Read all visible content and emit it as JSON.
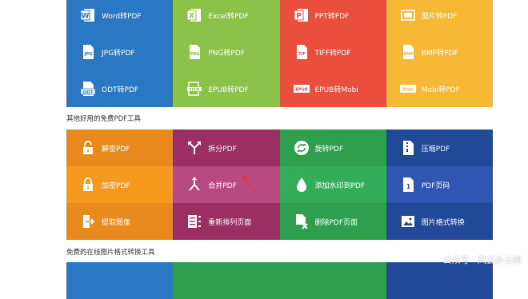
{
  "section1": {
    "tiles": [
      {
        "label": "Word转PDF",
        "icon": "word-doc-icon",
        "color": "#2a78c4"
      },
      {
        "label": "Excel转PDF",
        "icon": "excel-doc-icon",
        "color": "#8bc34a"
      },
      {
        "label": "PPT转PDF",
        "icon": "ppt-doc-icon",
        "color": "#e94f3c"
      },
      {
        "label": "图片转PDF",
        "icon": "image-frame-icon",
        "color": "#f6b935"
      },
      {
        "label": "JPG转PDF",
        "icon": "jpg-file-icon",
        "color": "#2a78c4"
      },
      {
        "label": "PNG转PDF",
        "icon": "png-file-icon",
        "color": "#8bc34a"
      },
      {
        "label": "TIFF转PDF",
        "icon": "tiff-file-icon",
        "color": "#e94f3c"
      },
      {
        "label": "BMP转PDF",
        "icon": "bmp-file-icon",
        "color": "#f6b935"
      },
      {
        "label": "ODT转PDF",
        "icon": "odt-file-icon",
        "color": "#2a78c4"
      },
      {
        "label": "EPUB转PDF",
        "icon": "epub-book-icon",
        "color": "#8bc34a"
      },
      {
        "label": "EPUB转Mobi",
        "icon": "epub-badge-icon",
        "color": "#e94f3c"
      },
      {
        "label": "Mobi转PDF",
        "icon": "mobi-badge-icon",
        "color": "#f6b935"
      }
    ]
  },
  "section2": {
    "title": "其他好用的免费PDF工具",
    "tiles": [
      {
        "label": "解密PDF",
        "icon": "unlock-icon",
        "color": "#e88a1d"
      },
      {
        "label": "拆分PDF",
        "icon": "split-arrows-icon",
        "color": "#9c2f62"
      },
      {
        "label": "旋转PDF",
        "icon": "rotate-icon",
        "color": "#2e9e4f"
      },
      {
        "label": "压缩PDF",
        "icon": "zip-file-icon",
        "color": "#22489a"
      },
      {
        "label": "加密PDF",
        "icon": "lock-icon",
        "color": "#f5991f"
      },
      {
        "label": "合并PDF",
        "icon": "merge-arrows-icon",
        "color": "#b84a80"
      },
      {
        "label": "添加水印到PDF",
        "icon": "water-drop-icon",
        "color": "#34ad5b"
      },
      {
        "label": "PDF页码",
        "icon": "page-number-icon",
        "color": "#2f56b3"
      },
      {
        "label": "提取图像",
        "icon": "extract-icon",
        "color": "#e88a1d"
      },
      {
        "label": "重新排列页面",
        "icon": "reorder-list-icon",
        "color": "#9c2f62"
      },
      {
        "label": "删除PDF页面",
        "icon": "delete-page-icon",
        "color": "#2e9e4f"
      },
      {
        "label": "图片格式转换",
        "icon": "picture-icon",
        "color": "#22489a"
      }
    ]
  },
  "section3": {
    "title": "免费的在线图片格式转换工具",
    "colors": [
      "#2a78c4",
      "#2e9e4f",
      "#2e9e4f",
      "#22489a"
    ]
  },
  "watermark": "公众号 · 风云办公网",
  "colors": {
    "arrow": "#e53935"
  }
}
